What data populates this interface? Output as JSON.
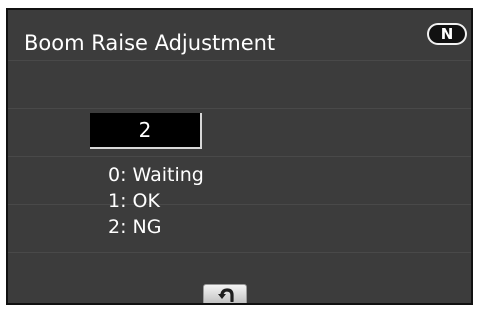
{
  "screen": {
    "title": "Boom Raise Adjustment",
    "mode_indicator": "N"
  },
  "adjustment": {
    "current_value": "2"
  },
  "legend": {
    "items": [
      {
        "text": "0: Waiting"
      },
      {
        "text": "1: OK"
      },
      {
        "text": "2: NG"
      }
    ]
  },
  "footer": {
    "back_button_icon": "return-arrow-icon"
  },
  "colors": {
    "panel_background": "#3c3c3c",
    "text": "#ffffff",
    "value_box": "#000000"
  }
}
